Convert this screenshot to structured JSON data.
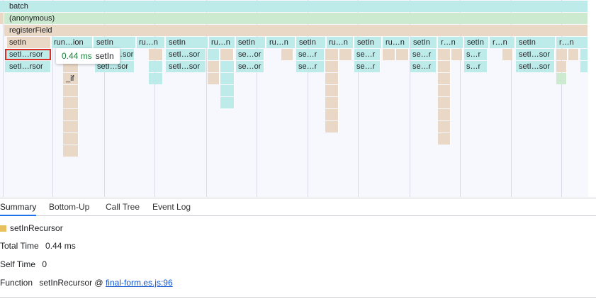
{
  "flame_chart": {
    "rows": [
      {
        "blocks": [
          {
            "label": "batch",
            "color": "cyan"
          }
        ]
      },
      {
        "blocks": [
          {
            "label": "(anonymous)",
            "color": "green"
          }
        ]
      },
      {
        "blocks": [
          {
            "label": "registerField",
            "color": "tan"
          }
        ]
      },
      {
        "blocks": [
          {
            "label": "setIn",
            "color": "tan"
          },
          {
            "label": "run…ion",
            "color": "cyan"
          },
          {
            "label": "setIn",
            "color": "cyan"
          },
          {
            "label": "ru…n",
            "color": "cyan"
          },
          {
            "label": "setIn",
            "color": "cyan"
          },
          {
            "label": "ru…n",
            "color": "cyan"
          },
          {
            "label": "setIn",
            "color": "cyan"
          },
          {
            "label": "ru…n",
            "color": "cyan"
          },
          {
            "label": "setIn",
            "color": "cyan"
          },
          {
            "label": "ru…n",
            "color": "cyan"
          },
          {
            "label": "setIn",
            "color": "cyan"
          },
          {
            "label": "ru…n",
            "color": "cyan"
          },
          {
            "label": "setIn",
            "color": "cyan"
          },
          {
            "label": "r…n",
            "color": "cyan"
          },
          {
            "label": "setIn",
            "color": "cyan"
          },
          {
            "label": "r…n",
            "color": "cyan"
          },
          {
            "label": "setIn",
            "color": "cyan"
          },
          {
            "label": "r…n",
            "color": "cyan"
          }
        ]
      },
      {
        "blocks": [
          {
            "label": "setI…rsor",
            "color": "cyan"
          },
          {
            "label": "…sor",
            "color": "cyan"
          },
          {
            "label": "setI…sor",
            "color": "cyan"
          },
          {
            "label": "se…or",
            "color": "cyan"
          },
          {
            "label": "se…r",
            "color": "cyan"
          },
          {
            "label": "se…r",
            "color": "cyan"
          },
          {
            "label": "se…r",
            "color": "cyan"
          },
          {
            "label": "s…r",
            "color": "cyan"
          },
          {
            "label": "setI…sor",
            "color": "cyan"
          }
        ]
      },
      {
        "blocks": [
          {
            "label": "setI…rsor",
            "color": "cyan"
          },
          {
            "label": "setI…sor",
            "color": "cyan"
          },
          {
            "label": "setI…sor",
            "color": "cyan"
          },
          {
            "label": "se…or",
            "color": "cyan"
          },
          {
            "label": "se…r",
            "color": "cyan"
          },
          {
            "label": "se…r",
            "color": "cyan"
          },
          {
            "label": "se…r",
            "color": "cyan"
          },
          {
            "label": "s…r",
            "color": "cyan"
          },
          {
            "label": "setI…sor",
            "color": "cyan"
          }
        ]
      },
      {
        "blocks": [
          {
            "label": "_if",
            "color": "tan"
          }
        ]
      }
    ],
    "selected_label": "setI…rsor"
  },
  "tooltip": {
    "duration": "0.44 ms",
    "name": "setIn"
  },
  "tabs": [
    {
      "label": "Summary",
      "active": true
    },
    {
      "label": "Bottom-Up",
      "active": false
    },
    {
      "label": "Call Tree",
      "active": false
    },
    {
      "label": "Event Log",
      "active": false
    }
  ],
  "summary": {
    "title": "setInRecursor",
    "swatch_color": "#e8c15f",
    "total_time_label": "Total Time",
    "total_time_value": "0.44 ms",
    "self_time_label": "Self Time",
    "self_time_value": "0",
    "function_label": "Function",
    "function_name": "setInRecursor @",
    "function_link": "final-form.es.js:96"
  },
  "colors": {
    "cyan": "#bdebea",
    "tan": "#ead8c6",
    "green": "#cbead0",
    "accent": "#1a73e8",
    "selection": "#d93025"
  }
}
